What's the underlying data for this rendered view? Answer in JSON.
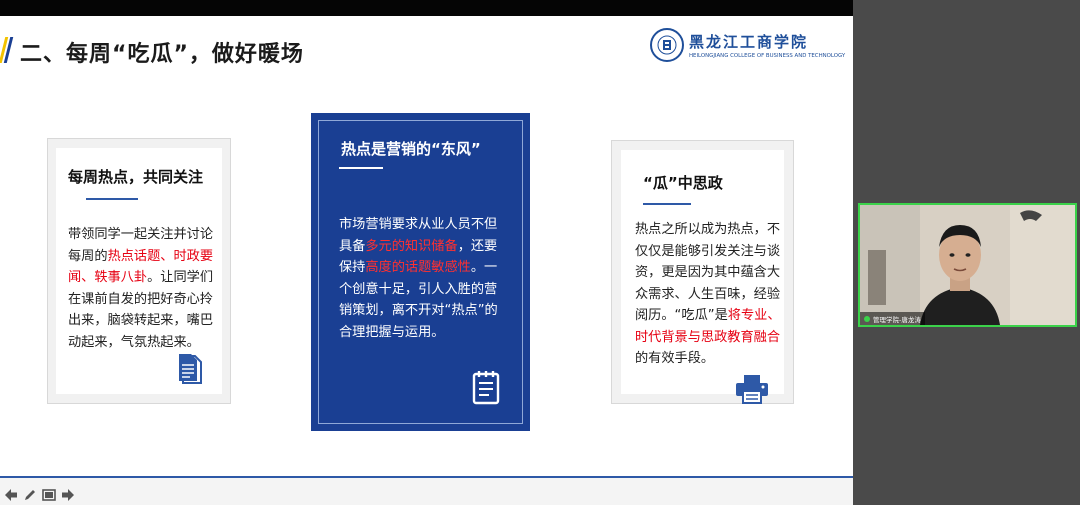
{
  "slide": {
    "title": "二、每周“吃瓜”，做好暖场",
    "logo": {
      "name_cn": "黑龙江工商学院",
      "name_en": "HEILONGJIANG COLLEGE OF BUSINESS AND TECHNOLOGY"
    },
    "cards": [
      {
        "heading": "每周热点，共同关注",
        "body_segments": [
          {
            "text": "带领同学一起关注并讨论每周的",
            "hl": false
          },
          {
            "text": "热点话题、时政要闻、轶事八卦",
            "hl": true
          },
          {
            "text": "。让同学们在课前自发的把好奇心拎出来，脑袋转起来，嘴巴动起来，气氛热起来。",
            "hl": false
          }
        ],
        "icon": "document-icon"
      },
      {
        "heading": "热点是营销的“东风”",
        "body_segments": [
          {
            "text": "市场营销要求从业人员不但具备",
            "hl": false
          },
          {
            "text": "多元的知识储备",
            "hl": true
          },
          {
            "text": "，还要保持",
            "hl": false
          },
          {
            "text": "高度的话题敏感性",
            "hl": true
          },
          {
            "text": "。一个创意十足，引人入胜的营销策划，离不开对“热点”的合理把握与运用。",
            "hl": false
          }
        ],
        "icon": "notepad-icon"
      },
      {
        "heading": "“瓜”中思政",
        "body_segments": [
          {
            "text": "热点之所以成为热点，不仅仅是能够引发关注与谈资，更是因为其中蕴含大众需求、人生百味，经验阅历。“吃瓜”是",
            "hl": false
          },
          {
            "text": "将专业、时代背景与思政教育融合",
            "hl": true
          },
          {
            "text": "的有效手段。",
            "hl": false
          }
        ],
        "icon": "printer-icon"
      }
    ]
  },
  "toolbar": {
    "buttons": [
      "arrow-left-icon",
      "pen-icon",
      "slides-icon",
      "arrow-right-icon"
    ]
  },
  "video": {
    "participant_name": "管理学院-唐龙涛"
  },
  "colors": {
    "accent_blue": "#1a3f93",
    "highlight_red": "#e60012",
    "accent_yellow": "#f2c200",
    "video_border": "#3bd24a"
  }
}
